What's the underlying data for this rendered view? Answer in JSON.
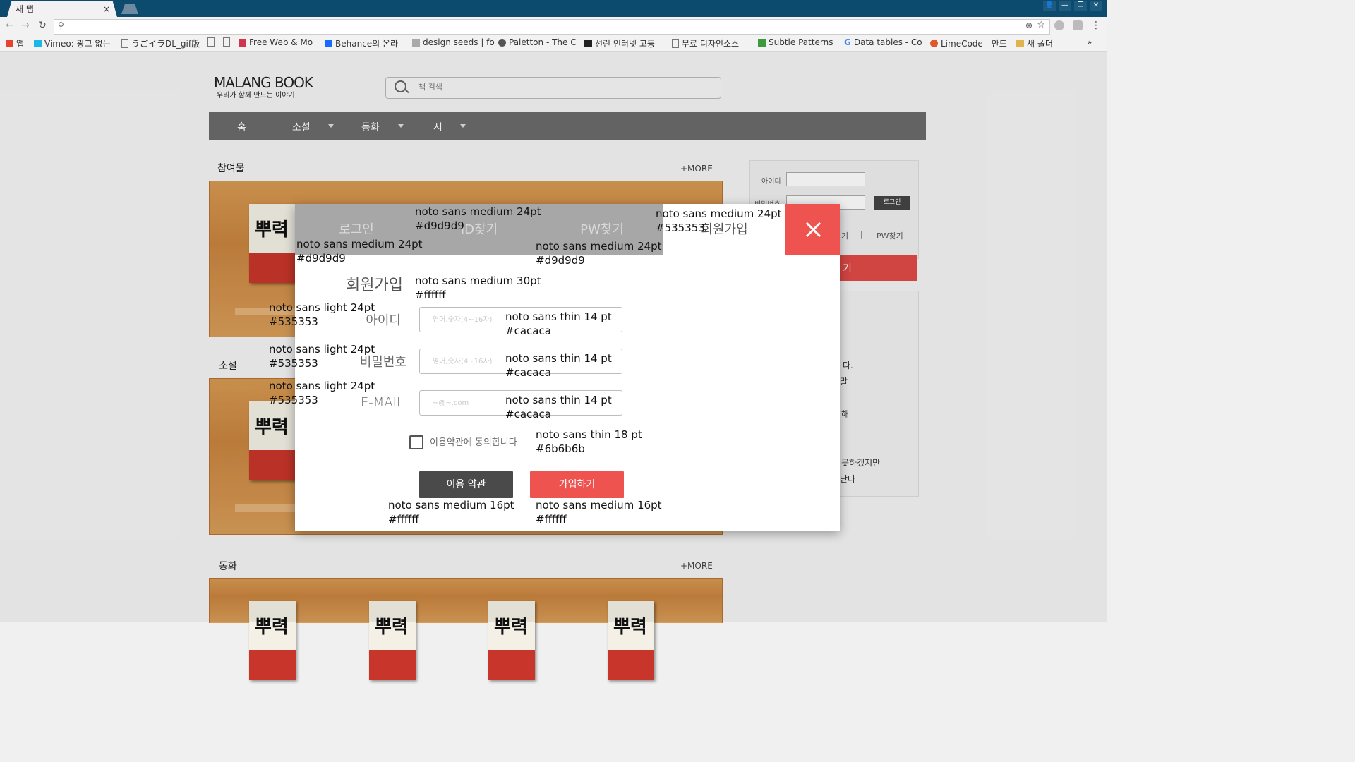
{
  "browser": {
    "tab_title": "새 탭",
    "tab_close": "×",
    "window_controls": [
      "👤",
      "—",
      "❐",
      "✕"
    ],
    "bookmarks": [
      {
        "label": "앱",
        "icon": "apps-grid-icon",
        "color": "#e94235"
      },
      {
        "label": "Vimeo: 광고 없는",
        "icon": "vimeo-icon",
        "color": "#1ab7ea"
      },
      {
        "label": "うごイラDL_gif版",
        "icon": "page-icon",
        "color": "#888888"
      },
      {
        "label": "",
        "icon": "page-icon",
        "color": "#888888"
      },
      {
        "label": "",
        "icon": "page-icon",
        "color": "#888888"
      },
      {
        "label": "Free Web & Mo",
        "icon": "invision-icon",
        "color": "#d1344f"
      },
      {
        "label": "Behance의 온라",
        "icon": "behance-icon",
        "color": "#1769ff"
      },
      {
        "label": "design seeds | fo",
        "icon": "design-seeds-icon",
        "color": "#999999"
      },
      {
        "label": "Paletton - The C",
        "icon": "paletton-icon",
        "color": "#555555"
      },
      {
        "label": "선린 인터넷 고등",
        "icon": "school-icon",
        "color": "#222222"
      },
      {
        "label": "무료 디자인소스",
        "icon": "page-icon",
        "color": "#888888"
      },
      {
        "label": "Subtle Patterns",
        "icon": "subtle-patterns-icon",
        "color": "#3c9a3c"
      },
      {
        "label": "Data tables - Co",
        "icon": "google-icon",
        "color": "#4285f4"
      },
      {
        "label": "LimeCode - 안드",
        "icon": "limecode-icon",
        "color": "#e0572b"
      },
      {
        "label": "새 폴더",
        "icon": "folder-icon",
        "color": "#e2b34a"
      }
    ],
    "bookmarks_overflow": "»"
  },
  "site": {
    "logo": "MALANG BOOK",
    "tagline": "우리가 함께 만드는 이야기",
    "search_placeholder": "책 검색",
    "nav": [
      "홈",
      "소설",
      "동화",
      "시"
    ],
    "sections": {
      "participation": "참여물",
      "novel": "소설",
      "fairy_tale": "동화",
      "more": "+MORE"
    },
    "side_login": {
      "id_label": "아이디",
      "pw_label": "비밀번호",
      "login_button": "로그인",
      "links_tail": "기",
      "divider": "|",
      "pw_find": "PW찾기",
      "red_button_tail": "기"
    },
    "notice_fragments": [
      "다.",
      "말",
      "해",
      "못하겠지만",
      "난다"
    ]
  },
  "modal": {
    "tabs": [
      "로그인",
      "ID찾기",
      "PW찾기"
    ],
    "active_tab": "회원가입",
    "heading": "회원가입",
    "fields": [
      {
        "label": "아이디",
        "placeholder": "영어,숫자(4~16자)"
      },
      {
        "label": "비밀번호",
        "placeholder": "영어,숫자(4~16자)"
      },
      {
        "label": "E-MAIL",
        "placeholder": "~@~.com"
      }
    ],
    "agree_label": "이용약관에 동의합니다",
    "terms_button": "이용 약관",
    "join_button": "가입하기",
    "colors": {
      "tab_bg": "#a7a7a7",
      "accent": "#ef5350",
      "dark_button": "#4a4a4a"
    }
  },
  "annotations": {
    "tab_spec_a": "noto sans medium 24pt",
    "tab_spec_a_color": "#d9d9d9",
    "tab_spec_b": "noto sans medium 24pt",
    "tab_spec_b_color": "#d9d9d9",
    "tab_spec_c": "noto sans medium 24pt",
    "tab_spec_c_color": "#d9d9d9",
    "active_spec": "noto sans medium 24pt",
    "active_spec_color": "#535353",
    "heading_spec": "noto sans medium 30pt",
    "heading_spec_color": "#ffffff",
    "label_spec": "noto sans light 24pt",
    "label_spec_color": "#535353",
    "input_spec": "noto sans thin 14 pt",
    "input_spec_color": "#cacaca",
    "agree_spec": "noto sans thin 18 pt",
    "agree_spec_color": "#6b6b6b",
    "button_spec": "noto sans medium 16pt",
    "button_spec_color": "#ffffff"
  }
}
